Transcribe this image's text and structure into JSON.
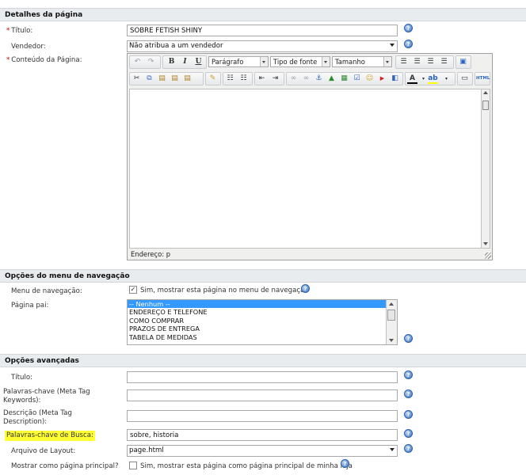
{
  "sections": {
    "page_details": "Detalhes da página",
    "nav_menu": "Opções do menu de navegação",
    "advanced": "Opções avançadas"
  },
  "details": {
    "title_label": "Título:",
    "title_value": "SOBRE FETISH SHINY",
    "vendor_label": "Vendedor:",
    "vendor_value": "Não atribua a um vendedor",
    "content_label": "Conteúdo da Página:"
  },
  "editor": {
    "format_value": "Parágrafo",
    "font_value": "Tipo de fonte",
    "size_value": "Tamanho",
    "status_path": "Endereço: p",
    "html_button": "HTML"
  },
  "nav": {
    "menu_label": "Menu de navegação:",
    "menu_checkbox_text": "Sim, mostrar esta página no menu de navegação",
    "menu_checked": true,
    "parent_label": "Página pai:",
    "parent_options": [
      "-- Nenhum --",
      "ENDEREÇO E TELEFONE",
      "COMO COMPRAR",
      "PRAZOS DE ENTREGA",
      "TABELA DE MEDIDAS"
    ],
    "parent_selected_index": 0
  },
  "advanced": {
    "title_label": "Título:",
    "title_value": "",
    "keywords_label": "Palavras-chave (Meta Tag Keywords):",
    "keywords_value": "",
    "description_label": "Descrição (Meta Tag Description):",
    "description_value": "",
    "search_keywords_label": "Palavras-chave de Busca:",
    "search_keywords_value": "sobre, historia",
    "layout_label": "Arquivo de Layout:",
    "layout_value": "page.html",
    "homepage_label": "Mostrar como página principal?",
    "homepage_checkbox_text": "Sim, mostrar esta página como página principal de minha loja",
    "homepage_checked": false
  },
  "colors": {
    "highlight": "#ffff33",
    "list_selected": "#3399ff",
    "help_icon": "#3a74c8",
    "required_star": "#cc0000"
  }
}
